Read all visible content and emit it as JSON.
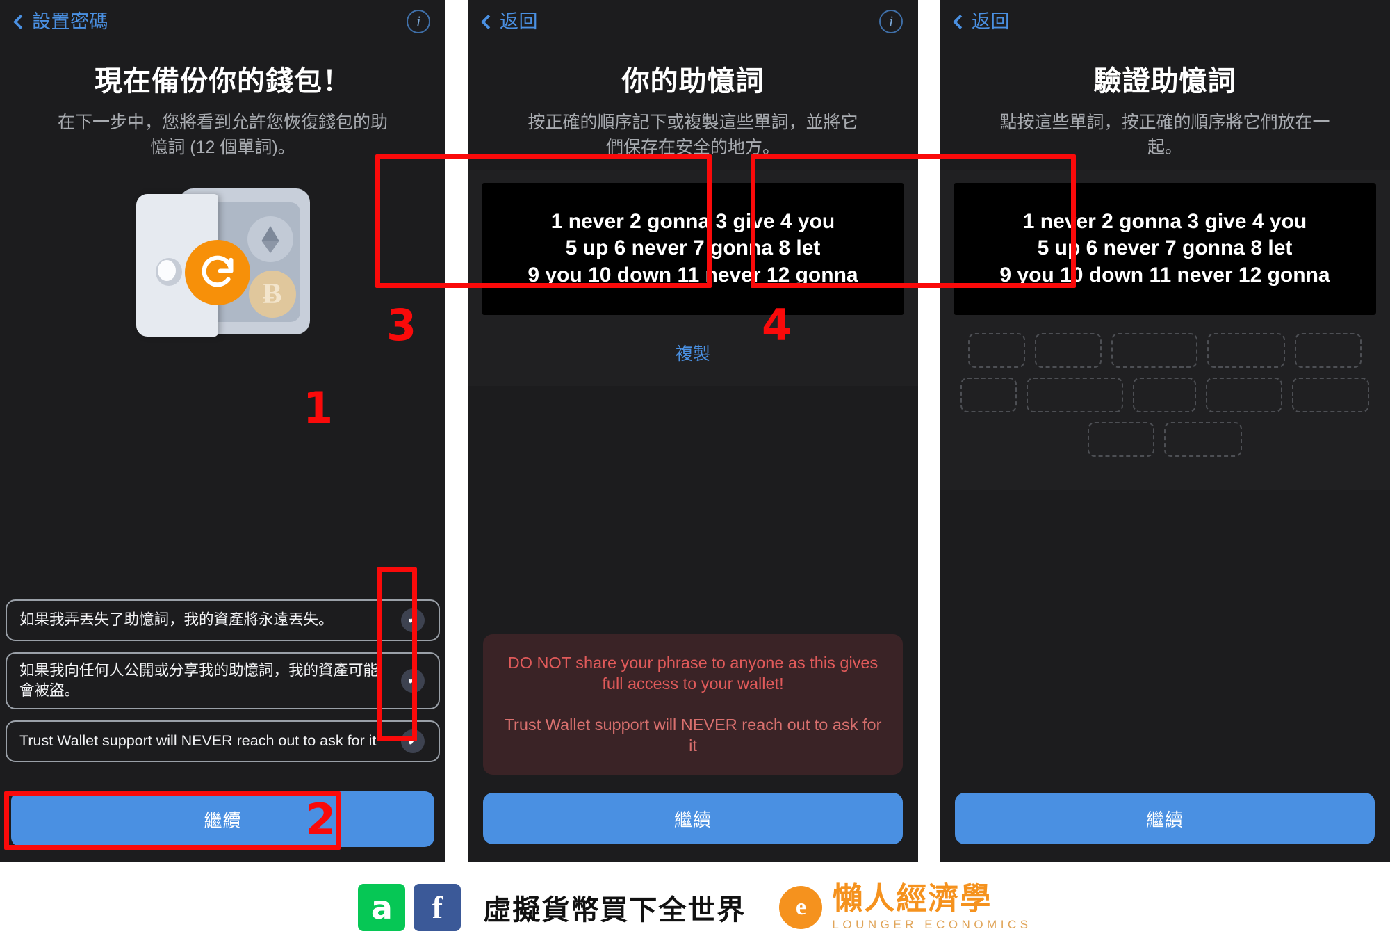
{
  "panels": [
    {
      "nav": {
        "back_label": "設置密碼",
        "info_icon": "info-circle-icon",
        "back_icon": "chevron-left-icon"
      },
      "title": "現在備份你的錢包！",
      "subtitle": "在下一步中，您將看到允許您恢復錢包的助憶詞 (12 個單詞)。",
      "illustration": {
        "name": "wallet-safe-illustration",
        "restore_icon": "refresh-restore-icon",
        "coins": [
          "ethereum-coin-icon",
          "bitcoin-coin-icon"
        ],
        "bitcoin_glyph": "Ƀ"
      },
      "checkboxes": [
        {
          "label": "如果我弄丟失了助憶詞，我的資產將永遠丟失。",
          "checked": true,
          "check_glyph": "✔"
        },
        {
          "label": "如果我向任何人公開或分享我的助憶詞，我的資產可能會被盜。",
          "checked": true,
          "check_glyph": "✔"
        },
        {
          "label": "Trust Wallet support will NEVER reach out to ask for it",
          "checked": true,
          "check_glyph": "✔"
        }
      ],
      "primary_button": "繼續"
    },
    {
      "nav": {
        "back_label": "返回",
        "info_icon": "info-circle-icon",
        "back_icon": "chevron-left-icon"
      },
      "title": "你的助憶詞",
      "subtitle": "按正確的順序記下或複製這些單詞，並將它們保存在安全的地方。",
      "mnemonic_lines": [
        "1 never 2 gonna 3 give 4 you",
        "5 up 6 never 7 gonna 8 let",
        "9 you 10 down 11 never 12 gonna"
      ],
      "copy_label": "複製",
      "warning_primary": "DO NOT share your phrase to anyone as this gives full access to your wallet!",
      "warning_secondary": "Trust Wallet support will NEVER reach out to ask for it",
      "primary_button": "繼續"
    },
    {
      "nav": {
        "back_label": "返回",
        "back_icon": "chevron-left-icon"
      },
      "title": "驗證助憶詞",
      "subtitle": "點按這些單詞，按正確的順序將它們放在一起。",
      "mnemonic_lines": [
        "1 never 2 gonna 3 give 4 you",
        "5 up 6 never 7 gonna 8 let",
        "9 you 10 down 11 never 12 gonna"
      ],
      "slot_rows": [
        [
          82,
          96,
          124,
          112,
          96
        ],
        [
          82,
          140,
          92,
          112,
          112
        ],
        [
          96,
          112
        ]
      ],
      "primary_button": "繼續"
    }
  ],
  "annotations": {
    "step_1": "1",
    "step_2": "2",
    "step_3": "3",
    "step_4": "4",
    "box_color": "#fa0a0a"
  },
  "footer": {
    "line_badge": "a",
    "facebook_badge": "f",
    "slogan": "虛擬貨幣買下全世界",
    "brand_mark": "e",
    "brand_cn": "懶人經濟學",
    "brand_en": "LOUNGER ECONOMICS"
  }
}
